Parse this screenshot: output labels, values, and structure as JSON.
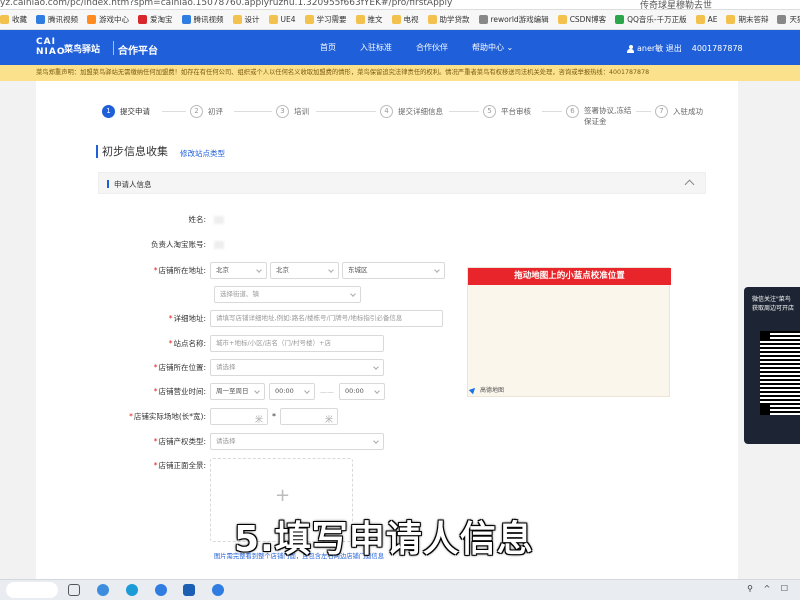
{
  "browser": {
    "url": "yz.cainiao.com/pc/index.htm?spm=cainiao.15078760.applyruzhu.1.320955f663fYEK#/pro/firstApply",
    "right_hint": "传奇球星穆勒去世",
    "bookmarks": [
      {
        "label": "收藏",
        "icon": "folder-icon"
      },
      {
        "label": "腾讯视频",
        "icon": "tencent-video-icon"
      },
      {
        "label": "游戏中心",
        "icon": "game-center-icon"
      },
      {
        "label": "爱淘宝",
        "icon": "taobao-icon"
      },
      {
        "label": "腾讯视频",
        "icon": "tencent-video-icon"
      },
      {
        "label": "设计",
        "icon": "folder-icon"
      },
      {
        "label": "UE4",
        "icon": "folder-icon"
      },
      {
        "label": "学习需要",
        "icon": "folder-icon"
      },
      {
        "label": "推文",
        "icon": "folder-icon"
      },
      {
        "label": "电视",
        "icon": "folder-icon"
      },
      {
        "label": "助学贷款",
        "icon": "folder-icon"
      },
      {
        "label": "reworld游戏编辑",
        "icon": "page-icon"
      },
      {
        "label": "CSDN博客",
        "icon": "folder-icon"
      },
      {
        "label": "QQ音乐-千万正版",
        "icon": "qq-music-icon"
      },
      {
        "label": "AE",
        "icon": "folder-icon"
      },
      {
        "label": "期末答辩",
        "icon": "folder-icon"
      },
      {
        "label": "天猫商城 后台管",
        "icon": "globe-icon"
      }
    ]
  },
  "header": {
    "logo_en": "CAI NIAO",
    "logo_cn": "菜鸟驿站",
    "platform": "合作平台",
    "nav": [
      "首页",
      "入驻标准",
      "合作伙伴",
      "帮助中心"
    ],
    "user": "aner敏 退出",
    "hotline": "4001787878",
    "brand_color": "#1f5fd9"
  },
  "notice": "菜鸟郑重声明：加盟菜鸟驿站无需缴纳任何加盟费！如存在有任何公司、组织或个人以任何名义收取加盟费的情形，菜鸟保留追究法律责任的权利。情况严重者菜鸟有权移送司法机关处理，咨询或举报热线：4001787878",
  "steps": [
    {
      "num": "1",
      "label": "提交申请",
      "active": true
    },
    {
      "num": "2",
      "label": "初评",
      "active": false
    },
    {
      "num": "3",
      "label": "培训",
      "active": false
    },
    {
      "num": "4",
      "label": "提交详细信息",
      "active": false
    },
    {
      "num": "5",
      "label": "平台审核",
      "active": false
    },
    {
      "num": "6",
      "label": "签署协议,冻结保证金",
      "active": false
    },
    {
      "num": "7",
      "label": "入驻成功",
      "active": false
    }
  ],
  "section": {
    "title": "初步信息收集",
    "modify_link": "修改站点类型",
    "panel_title": "申请人信息"
  },
  "form": {
    "name_label": "姓名:",
    "taobao_label": "负责人淘宝账号:",
    "address_label": "店铺所在地址:",
    "province": "北京",
    "city": "北京",
    "district": "东城区",
    "street_placeholder": "选择街道、镇",
    "detail_label": "详细地址:",
    "detail_placeholder": "请填写店铺详细地址,例如:路名/楼栋号/门牌号/地标指引必备信息",
    "site_label": "站点名称:",
    "site_placeholder": "城市+地标/小区/店名（门/村号楼）+店",
    "position_label": "店铺所在位置:",
    "position_placeholder": "请选择",
    "hours_label": "店铺营业时间:",
    "days_value": "周一至周日",
    "start_time": "00:00",
    "hours_sep": "——",
    "end_time": "00:00",
    "area_label": "店铺实际场地(长*宽):",
    "area_sep": "*",
    "area_unit": "米",
    "property_label": "店铺产权类型:",
    "property_placeholder": "请选择",
    "photo_label": "店铺正面全景:",
    "upload_plus": "+",
    "photo_hint": "图片需完整看到整个店铺门面，且包含左右两边店铺门面信息",
    "required_mark": "*"
  },
  "map": {
    "banner": "拖动地图上的小蓝点校准位置",
    "logo": "高德地图"
  },
  "qr": {
    "line1": "微信关注\"菜鸟",
    "line2": "获取周边可开店"
  },
  "subtitle": "5.填写申请人信息"
}
